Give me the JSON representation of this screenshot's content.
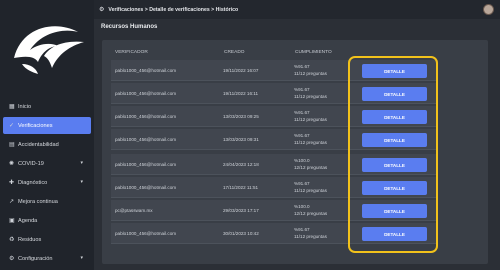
{
  "sidebar": {
    "items": [
      {
        "label": "Inicio",
        "icon": "grid-icon",
        "active": false,
        "chevron": false
      },
      {
        "label": "Verificaciones",
        "icon": "check-icon",
        "active": true,
        "chevron": false
      },
      {
        "label": "Accidentabilidad",
        "icon": "report-icon",
        "active": false,
        "chevron": false
      },
      {
        "label": "COVID-19",
        "icon": "virus-icon",
        "active": false,
        "chevron": true
      },
      {
        "label": "Diagnóstico",
        "icon": "diagnosis-icon",
        "active": false,
        "chevron": true
      },
      {
        "label": "Mejora continua",
        "icon": "chart-icon",
        "active": false,
        "chevron": false
      },
      {
        "label": "Agenda",
        "icon": "calendar-icon",
        "active": false,
        "chevron": false
      },
      {
        "label": "Residuos",
        "icon": "recycle-icon",
        "active": false,
        "chevron": false
      },
      {
        "label": "Configuración",
        "icon": "settings-icon",
        "active": false,
        "chevron": true
      }
    ]
  },
  "header": {
    "breadcrumb": "Verificaciones > Detalle de verificaciones > Histórico"
  },
  "section": {
    "title": "Recursos Humanos"
  },
  "table": {
    "columns": [
      "VERIFICADOR",
      "CREADO",
      "CUMPLIMIENTO"
    ],
    "rows": [
      {
        "email": "pablo1000_456@hotmail.com",
        "created": "19/11/2022 16:07",
        "pct": "%91.67",
        "questions": "11/12 preguntas",
        "action": "DETALLE"
      },
      {
        "email": "pablo1000_456@hotmail.com",
        "created": "19/11/2022 16:11",
        "pct": "%91.67",
        "questions": "11/12 preguntas",
        "action": "DETALLE"
      },
      {
        "email": "pablo1000_456@hotmail.com",
        "created": "13/03/2023 09:25",
        "pct": "%91.67",
        "questions": "11/12 preguntas",
        "action": "DETALLE"
      },
      {
        "email": "pablo1000_456@hotmail.com",
        "created": "13/03/2023 09:31",
        "pct": "%91.67",
        "questions": "11/12 preguntas",
        "action": "DETALLE"
      },
      {
        "email": "pablo1000_456@hotmail.com",
        "created": "24/04/2023 12:18",
        "pct": "%100.0",
        "questions": "12/12 preguntas",
        "action": "DETALLE"
      },
      {
        "email": "pablo1000_456@hotmail.com",
        "created": "17/11/2022 11:51",
        "pct": "%91.67",
        "questions": "11/12 preguntas",
        "action": "DETALLE"
      },
      {
        "email": "pc@ptasswam.mx",
        "created": "29/03/2023 17:17",
        "pct": "%100.0",
        "questions": "12/12 preguntas",
        "action": "DETALLE"
      },
      {
        "email": "pablo1000_456@hotmail.com",
        "created": "30/01/2023 10:42",
        "pct": "%91.67",
        "questions": "11/12 preguntas",
        "action": "DETALLE"
      }
    ]
  },
  "colors": {
    "accent": "#5a7df0",
    "highlight": "#f2c21b"
  }
}
